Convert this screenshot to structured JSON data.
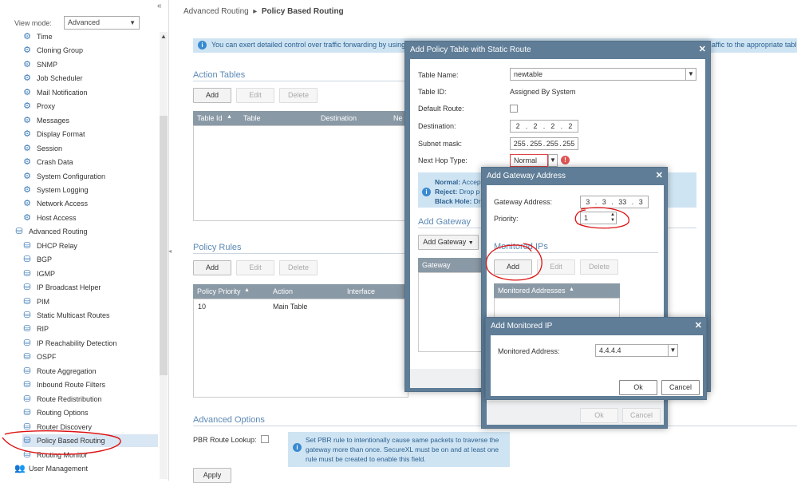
{
  "sidebar": {
    "view_mode_label": "View mode:",
    "view_mode_value": "Advanced",
    "items": [
      {
        "label": "Time",
        "icon": "gear-icon",
        "level": 2
      },
      {
        "label": "Cloning Group",
        "icon": "gear-icon",
        "level": 2
      },
      {
        "label": "SNMP",
        "icon": "gear-icon",
        "level": 2
      },
      {
        "label": "Job Scheduler",
        "icon": "gear-icon",
        "level": 2
      },
      {
        "label": "Mail Notification",
        "icon": "gear-icon",
        "level": 2
      },
      {
        "label": "Proxy",
        "icon": "gear-icon",
        "level": 2
      },
      {
        "label": "Messages",
        "icon": "gear-icon",
        "level": 2
      },
      {
        "label": "Display Format",
        "icon": "gear-icon",
        "level": 2
      },
      {
        "label": "Session",
        "icon": "gear-icon",
        "level": 2
      },
      {
        "label": "Crash Data",
        "icon": "gear-icon",
        "level": 2
      },
      {
        "label": "System Configuration",
        "icon": "gear-icon",
        "level": 2
      },
      {
        "label": "System Logging",
        "icon": "gear-icon",
        "level": 2
      },
      {
        "label": "Network Access",
        "icon": "gear-icon",
        "level": 2
      },
      {
        "label": "Host Access",
        "icon": "gear-icon",
        "level": 2
      },
      {
        "label": "Advanced Routing",
        "icon": "routing-icon",
        "level": 1
      },
      {
        "label": "DHCP Relay",
        "icon": "routing-icon",
        "level": 2
      },
      {
        "label": "BGP",
        "icon": "routing-icon",
        "level": 2
      },
      {
        "label": "IGMP",
        "icon": "routing-icon",
        "level": 2
      },
      {
        "label": "IP Broadcast Helper",
        "icon": "routing-icon",
        "level": 2
      },
      {
        "label": "PIM",
        "icon": "routing-icon",
        "level": 2
      },
      {
        "label": "Static Multicast Routes",
        "icon": "routing-icon",
        "level": 2
      },
      {
        "label": "RIP",
        "icon": "routing-icon",
        "level": 2
      },
      {
        "label": "IP Reachability Detection",
        "icon": "routing-icon",
        "level": 2
      },
      {
        "label": "OSPF",
        "icon": "routing-icon",
        "level": 2
      },
      {
        "label": "Route Aggregation",
        "icon": "routing-icon",
        "level": 2
      },
      {
        "label": "Inbound Route Filters",
        "icon": "routing-icon",
        "level": 2
      },
      {
        "label": "Route Redistribution",
        "icon": "routing-icon",
        "level": 2
      },
      {
        "label": "Routing Options",
        "icon": "routing-icon",
        "level": 2
      },
      {
        "label": "Router Discovery",
        "icon": "routing-icon",
        "level": 2
      },
      {
        "label": "Policy Based Routing",
        "icon": "routing-icon",
        "level": 2,
        "selected": true
      },
      {
        "label": "Routing Monitor",
        "icon": "routing-icon",
        "level": 2
      },
      {
        "label": "User Management",
        "icon": "users-icon",
        "level": 1
      }
    ]
  },
  "breadcrumb": {
    "parent": "Advanced Routing",
    "current": "Policy Based Routing"
  },
  "info_bar": {
    "text": "You can exert detailed control over traffic forwarding by using p",
    "tail": "affic to the appropriate tabl"
  },
  "action_tables": {
    "title": "Action Tables",
    "buttons": {
      "add": "Add",
      "edit": "Edit",
      "delete": "Delete"
    },
    "columns": [
      "Table Id",
      "Table",
      "Destination",
      "Ne"
    ]
  },
  "policy_rules": {
    "title": "Policy Rules",
    "buttons": {
      "add": "Add",
      "edit": "Edit",
      "delete": "Delete"
    },
    "columns": [
      "Policy Priority",
      "Action",
      "Interface"
    ],
    "rows": [
      {
        "priority": "10",
        "action": "Main Table",
        "interface": ""
      }
    ]
  },
  "advanced_options": {
    "title": "Advanced Options",
    "pbr_label": "PBR Route Lookup:",
    "note": "Set PBR rule to intentionally cause same packets to traverse the gateway more than once. SecureXL must be on and at least one rule must be created to enable this field.",
    "apply": "Apply"
  },
  "dialog_policy": {
    "title": "Add Policy Table with Static Route",
    "table_name_label": "Table Name:",
    "table_name_value": "newtable",
    "table_id_label": "Table ID:",
    "table_id_value": "Assigned By System",
    "default_route_label": "Default Route:",
    "destination_label": "Destination:",
    "destination": [
      "2",
      "2",
      "2",
      "2"
    ],
    "subnet_label": "Subnet mask:",
    "subnet": [
      "255",
      "255",
      "255",
      "255"
    ],
    "next_hop_label": "Next Hop Type:",
    "next_hop_value": "Normal",
    "note_normal_key": "Normal:",
    "note_normal": "Accep",
    "note_reject_key": "Reject:",
    "note_reject": "Drop p",
    "note_blackhole_key": "Black Hole:",
    "note_blackhole": "Dr",
    "add_gateway_title": "Add Gateway",
    "add_gateway_button": "Add Gateway",
    "gateway_col": "Gateway"
  },
  "dialog_gateway": {
    "title": "Add Gateway Address",
    "gateway_label": "Gateway Address:",
    "gateway": [
      "3",
      "3",
      "33",
      "3"
    ],
    "priority_label": "Priority:",
    "priority_value": "1",
    "monitored_title": "Monitored IPs",
    "buttons": {
      "add": "Add",
      "edit": "Edit",
      "delete": "Delete"
    },
    "monitored_col": "Monitored Addresses",
    "ok": "Ok",
    "cancel": "Cancel"
  },
  "dialog_monitored": {
    "title": "Add Monitored IP",
    "address_label": "Monitored Address:",
    "address_value": "4.4.4.4",
    "ok": "Ok",
    "cancel": "Cancel"
  },
  "colors": {
    "accent": "#5b89b4",
    "dialog_title": "#5f7d97",
    "grid_head": "#8a99a6",
    "annotation": "#dd1111"
  }
}
